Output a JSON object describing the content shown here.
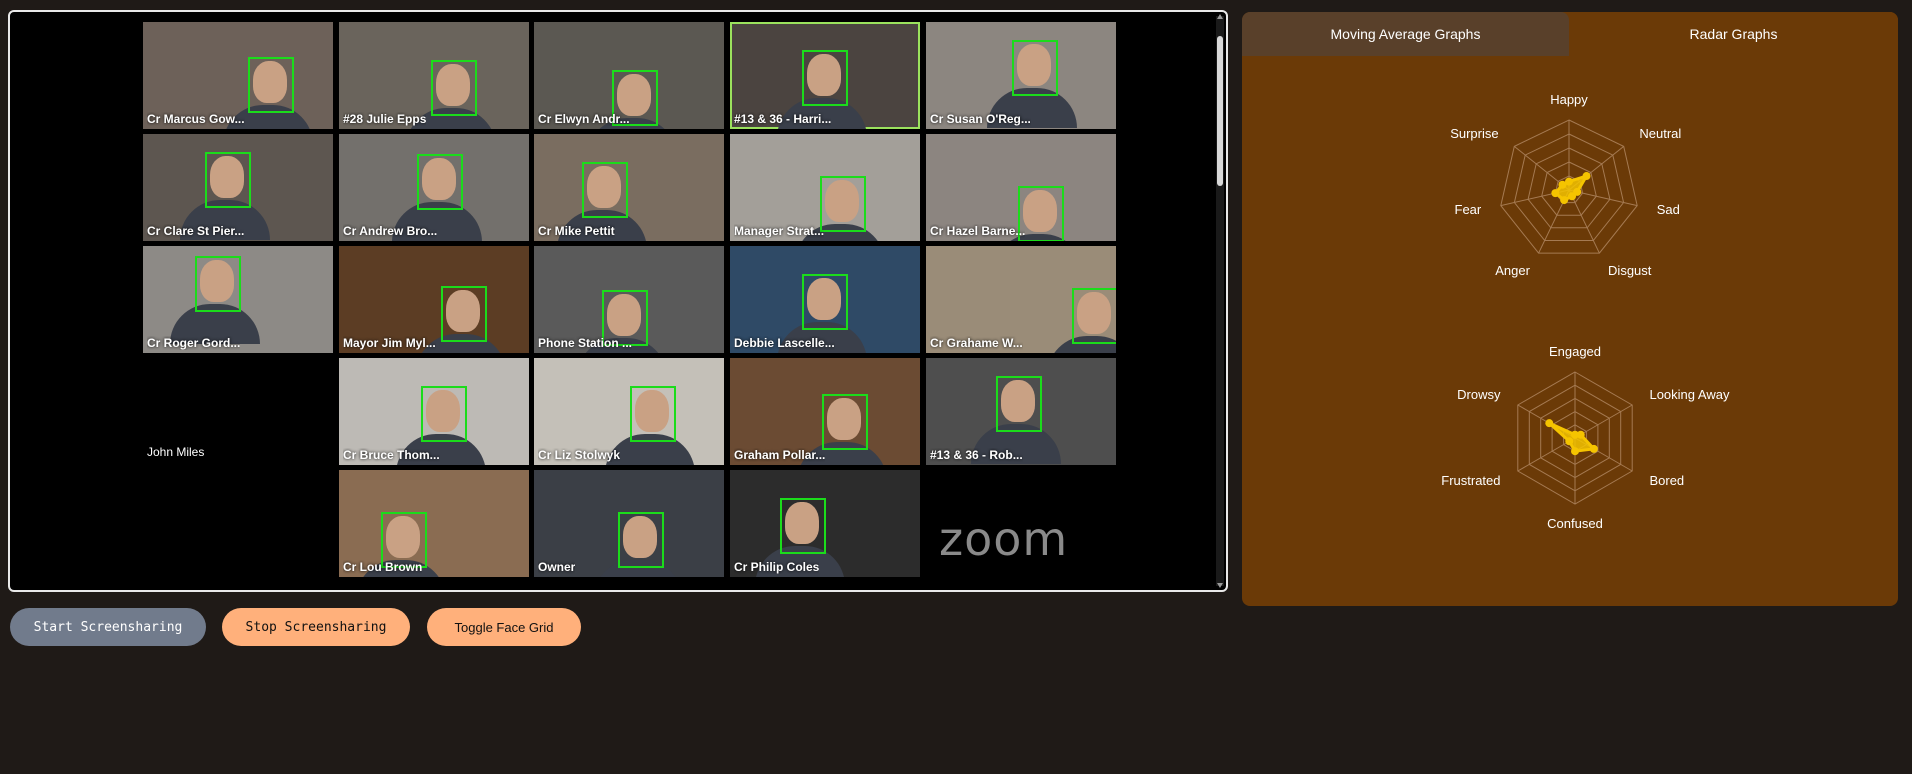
{
  "participants": [
    {
      "name": "Cr Marcus Gow...",
      "bg": "#6d6159"
    },
    {
      "name": "#28 Julie Epps",
      "bg": "#6a645c"
    },
    {
      "name": "Cr Elwyn Andr...",
      "bg": "#5b5852"
    },
    {
      "name": "#13 & 36 - Harri...",
      "bg": "#4b4440",
      "active": true
    },
    {
      "name": "Cr Susan O'Reg...",
      "bg": "#8c8680"
    },
    {
      "name": "Cr Clare St Pier...",
      "bg": "#5d5650"
    },
    {
      "name": "Cr Andrew Bro...",
      "bg": "#73706c"
    },
    {
      "name": "Cr Mike Pettit",
      "bg": "#7a6d60"
    },
    {
      "name": "Manager Strat...",
      "bg": "#a39f99"
    },
    {
      "name": "Cr Hazel Barne...",
      "bg": "#8c8580"
    },
    {
      "name": "Cr Roger Gord...",
      "bg": "#8d8a86"
    },
    {
      "name": "Mayor Jim Myl...",
      "bg": "#5c3d24"
    },
    {
      "name": "Phone Station ...",
      "bg": "#5a5a5a"
    },
    {
      "name": "Debbie Lascelle...",
      "bg": "#2f4a66"
    },
    {
      "name": "Cr Grahame W...",
      "bg": "#9a8c78"
    },
    {
      "name": "Cr Bruce Thom...",
      "bg": "#bdbab5"
    },
    {
      "name": "Cr Liz Stolwyk",
      "bg": "#c4c0b8"
    },
    {
      "name": "Graham Pollar...",
      "bg": "#6b4b33"
    },
    {
      "name": "#13 & 36 - Rob...",
      "bg": "#4e4e4e"
    },
    {
      "name": "Cr Lou Brown",
      "bg": "#8a6c52"
    },
    {
      "name": "Owner",
      "bg": "#3b3f46"
    },
    {
      "name": "Cr Philip Coles",
      "bg": "#2c2c2c"
    }
  ],
  "no_video_participant": "John Miles",
  "zoom_logo": "zoom",
  "tabs": {
    "moving_average": "Moving Average Graphs",
    "radar": "Radar Graphs",
    "active": "radar"
  },
  "radar_emotions": {
    "axes": [
      "Happy",
      "Neutral",
      "Sad",
      "Disgust",
      "Anger",
      "Fear",
      "Surprise"
    ],
    "values": [
      0.12,
      0.32,
      0.12,
      0.1,
      0.16,
      0.2,
      0.12
    ]
  },
  "radar_engagement": {
    "axes": [
      "Engaged",
      "Looking Away",
      "Bored",
      "Confused",
      "Frustrated",
      "Drowsy"
    ],
    "values": [
      0.05,
      0.1,
      0.33,
      0.2,
      0.1,
      0.45
    ]
  },
  "colors": {
    "radar_fill": "#f5c400",
    "radar_point": "#f5c400",
    "radar_grid": "#a57a52",
    "panel_bg": "#6b3a07"
  },
  "buttons": {
    "start": "Start Screensharing",
    "stop": "Stop Screensharing",
    "toggle_grid": "Toggle Face Grid"
  }
}
